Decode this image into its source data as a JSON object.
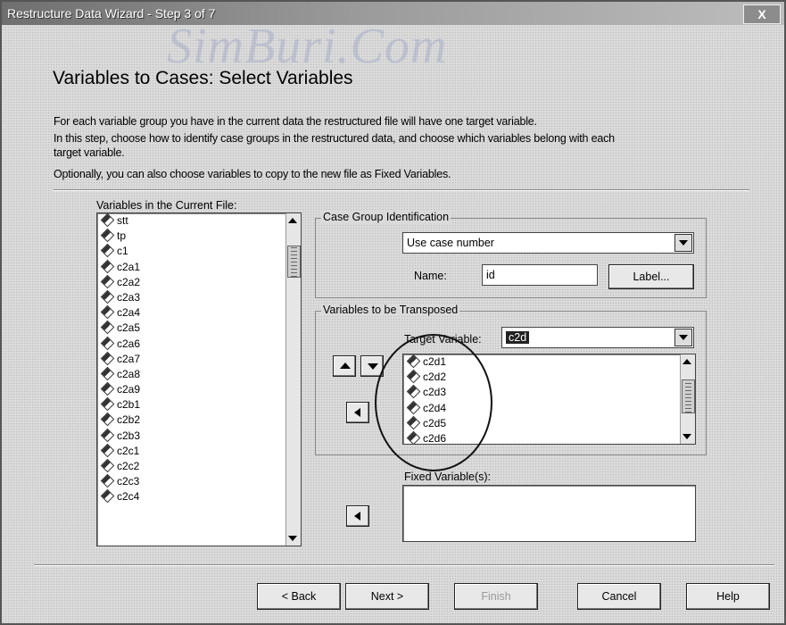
{
  "window": {
    "title": "Restructure Data Wizard - Step 3 of 7",
    "close_label": "X"
  },
  "watermark": "SimBuri.Com",
  "heading": "Variables to Cases: Select Variables",
  "descriptions": [
    "For each variable group you have in the current data the restructured file will have one target variable.",
    "In this step, choose how to identify case groups in the restructured data, and choose which variables belong with each",
    "target variable.",
    "Optionally, you can also choose variables to copy to the new file as Fixed Variables."
  ],
  "current_file": {
    "label": "Variables in the Current File:",
    "items": [
      "stt",
      "tp",
      "c1",
      "c2a1",
      "c2a2",
      "c2a3",
      "c2a4",
      "c2a5",
      "c2a6",
      "c2a7",
      "c2a8",
      "c2a9",
      "c2b1",
      "c2b2",
      "c2b3",
      "c2c1",
      "c2c2",
      "c2c3",
      "c2c4"
    ]
  },
  "case_group": {
    "legend": "Case Group Identification",
    "method": "Use case number",
    "name_label": "Name:",
    "name_value": "id",
    "label_button": "Label..."
  },
  "transposed": {
    "legend": "Variables to be Transposed",
    "target_label": "Target Variable:",
    "target_value": "c2d",
    "items": [
      "c2d1",
      "c2d2",
      "c2d3",
      "c2d4",
      "c2d5",
      "c2d6"
    ]
  },
  "fixed": {
    "label": "Fixed Variable(s):",
    "items": []
  },
  "buttons": {
    "back": "< Back",
    "next": "Next >",
    "finish": "Finish",
    "cancel": "Cancel",
    "help": "Help"
  },
  "icons": {
    "variable": "scale-variable-icon",
    "move": "arrow-left-icon",
    "up": "arrow-up-icon",
    "down": "arrow-down-icon"
  }
}
